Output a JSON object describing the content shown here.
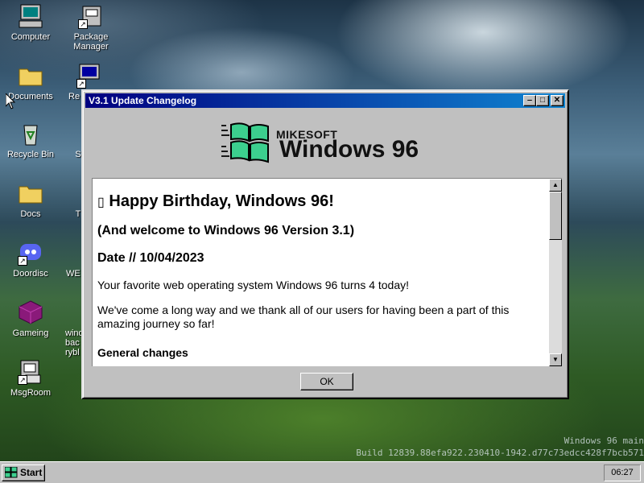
{
  "desktop": {
    "icons": [
      {
        "label": "Computer"
      },
      {
        "label": "Package\nManager"
      },
      {
        "label": "Documents"
      },
      {
        "label": "Re"
      },
      {
        "label": "Recycle Bin"
      },
      {
        "label": "S"
      },
      {
        "label": "Docs"
      },
      {
        "label": "T"
      },
      {
        "label": "Doordisc"
      },
      {
        "label": "WE"
      },
      {
        "label": "Gameing"
      },
      {
        "label": "wind\nbac\nrybl"
      },
      {
        "label": "MsgRoom"
      }
    ],
    "build_line1": "Windows 96 main",
    "build_line2": "Build 12839.88efa922.230410-1942.d77c73edcc428f7bcb571"
  },
  "window": {
    "title": "V3.1 Update Changelog",
    "logo_brand": "MIKESOFT",
    "logo_product": "Windows 96",
    "heading": "Happy Birthday, Windows 96!",
    "heading_glyph": "▯",
    "subheading": "(And welcome to Windows 96 Version 3.1)",
    "date_line": "Date // 10/04/2023",
    "para1": "Your favorite web operating system Windows 96 turns 4 today!",
    "para2": "We've come a long way and we thank all of our users for having been a part of this amazing journey so far!",
    "section_title": "General changes",
    "ok_label": "OK",
    "btn_minimize": "‒",
    "btn_maximize": "□",
    "btn_close": "✕"
  },
  "taskbar": {
    "start_label": "Start",
    "clock": "06:27"
  },
  "colors": {
    "titlebar_start": "#000080",
    "titlebar_end": "#1084d0",
    "face": "#c0c0c0"
  }
}
